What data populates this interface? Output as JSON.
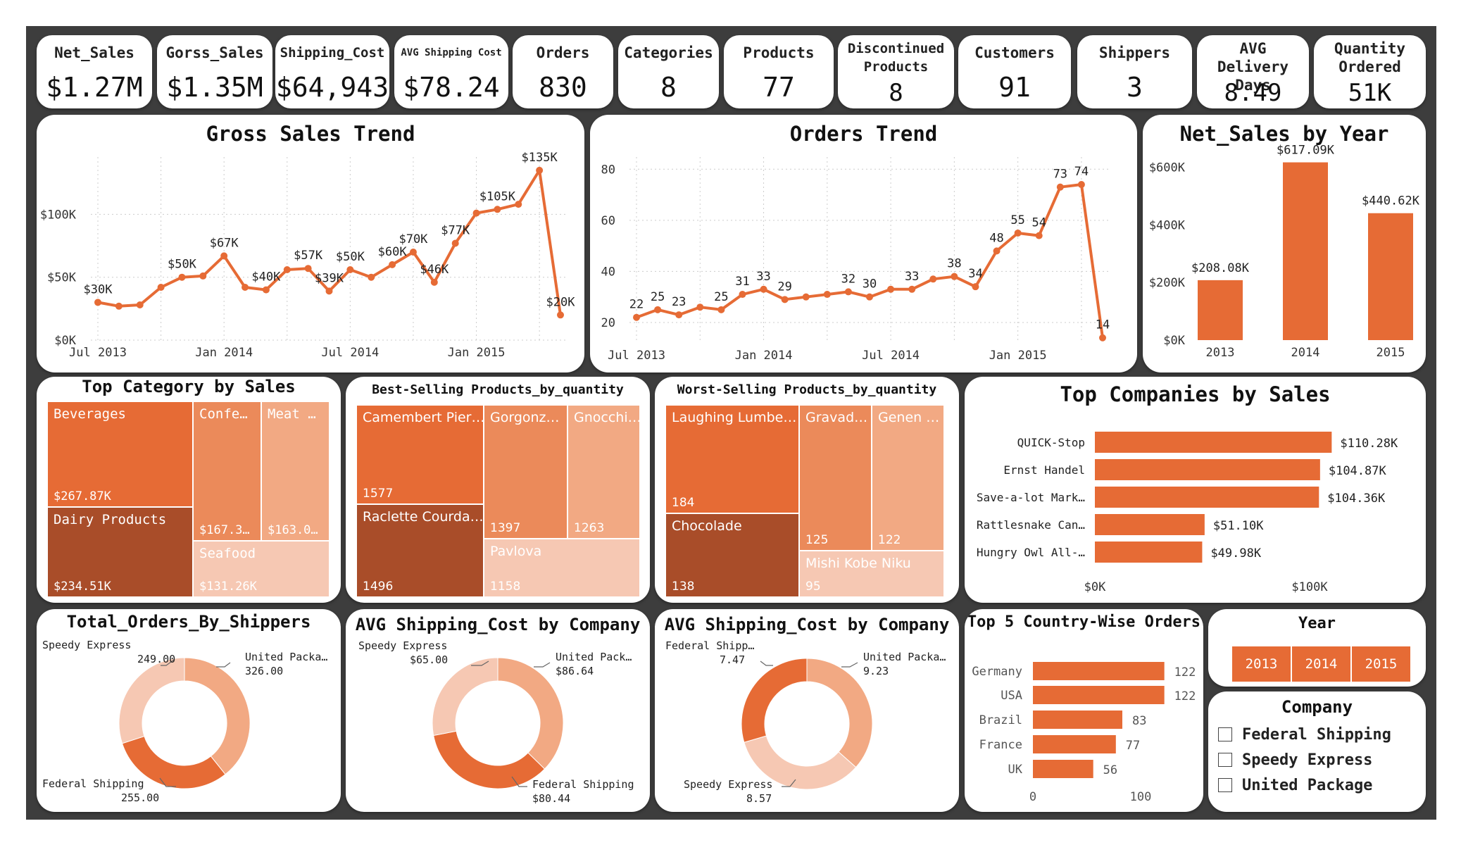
{
  "kpis": [
    {
      "label": "Net_Sales",
      "value": "$1.27M"
    },
    {
      "label": "Gorss_Sales",
      "value": "$1.35M"
    },
    {
      "label": "Shipping_Cost",
      "value": "$64,943"
    },
    {
      "label": "AVG Shipping Cost",
      "value": "$78.24"
    },
    {
      "label": "Orders",
      "value": "830"
    },
    {
      "label": "Categories",
      "value": "8"
    },
    {
      "label": "Products",
      "value": "77"
    },
    {
      "label": "Discontinued Products",
      "value": "8"
    },
    {
      "label": "Customers",
      "value": "91"
    },
    {
      "label": "Shippers",
      "value": "3"
    },
    {
      "label": "AVG Delivery Days",
      "value": "8.49"
    },
    {
      "label": "Quantity Ordered",
      "value": "51K"
    }
  ],
  "colors": {
    "accent": "#e66b35",
    "dark": "#a94d29",
    "mid": "#eb8a5a",
    "light": "#f2a983",
    "pale": "#f6c8b3",
    "frame": "#3d3d3d"
  },
  "chart_data": [
    {
      "type": "line",
      "title": "Gross Sales Trend",
      "x": [
        "2013-07",
        "2013-08",
        "2013-09",
        "2013-10",
        "2013-11",
        "2013-12",
        "2014-01",
        "2014-02",
        "2014-03",
        "2014-04",
        "2014-05",
        "2014-06",
        "2014-07",
        "2014-08",
        "2014-09",
        "2014-10",
        "2014-11",
        "2014-12",
        "2015-01",
        "2015-02",
        "2015-03",
        "2015-04",
        "2015-05"
      ],
      "values": [
        30000,
        27000,
        28000,
        42000,
        50000,
        51000,
        67000,
        42000,
        40000,
        56000,
        57000,
        39000,
        56000,
        50000,
        60000,
        70000,
        46000,
        77000,
        101000,
        104000,
        108000,
        135000,
        20000
      ],
      "point_labels": [
        "$30K",
        "",
        "",
        "",
        "$50K",
        "",
        "$67K",
        "",
        "$40K",
        "",
        "$57K",
        "$39K",
        "$50K",
        "",
        "$60K",
        "$70K",
        "$46K",
        "$77K",
        "",
        "$105K",
        "",
        "$135K",
        "$20K"
      ],
      "x_ticks": [
        "Jul 2013",
        "Jan 2014",
        "Jul 2014",
        "Jan 2015"
      ],
      "y_ticks": [
        "$0K",
        "$50K",
        "$100K"
      ],
      "ylim": [
        0,
        140000
      ],
      "grid": true
    },
    {
      "type": "line",
      "title": "Orders Trend",
      "x": [
        "2013-07",
        "2013-08",
        "2013-09",
        "2013-10",
        "2013-11",
        "2013-12",
        "2014-01",
        "2014-02",
        "2014-03",
        "2014-04",
        "2014-05",
        "2014-06",
        "2014-07",
        "2014-08",
        "2014-09",
        "2014-10",
        "2014-11",
        "2014-12",
        "2015-01",
        "2015-02",
        "2015-03",
        "2015-04",
        "2015-05"
      ],
      "values": [
        22,
        25,
        23,
        26,
        25,
        31,
        33,
        29,
        30,
        31,
        32,
        30,
        33,
        33,
        37,
        38,
        34,
        48,
        55,
        54,
        73,
        74,
        14
      ],
      "point_labels": [
        "22",
        "25",
        "23",
        "",
        "25",
        "31",
        "33",
        "29",
        "",
        "",
        "32",
        "30",
        "",
        "33",
        "",
        "38",
        "34",
        "48",
        "55",
        "54",
        "73",
        "74",
        "14"
      ],
      "x_ticks": [
        "Jul 2013",
        "Jan 2014",
        "Jul 2014",
        "Jan 2015"
      ],
      "y_ticks": [
        "20",
        "40",
        "60",
        "80"
      ],
      "ylim": [
        12,
        82
      ],
      "grid": true
    },
    {
      "type": "bar",
      "title": "Net_Sales by Year",
      "categories": [
        "2013",
        "2014",
        "2015"
      ],
      "values": [
        208080,
        617090,
        440620
      ],
      "value_labels": [
        "$208.08K",
        "$617.09K",
        "$440.62K"
      ],
      "y_ticks": [
        "$0K",
        "$200K",
        "$400K",
        "$600K"
      ],
      "ylim": [
        0,
        660000
      ]
    },
    {
      "type": "treemap",
      "title": "Top Category by Sales",
      "items": [
        {
          "name": "Beverages",
          "label": "$267.87K",
          "value": 267870
        },
        {
          "name": "Dairy Products",
          "label": "$234.51K",
          "value": 234510
        },
        {
          "name": "Confe…",
          "label": "$167.3…",
          "value": 167360
        },
        {
          "name": "Meat …",
          "label": "$163.0…",
          "value": 163020
        },
        {
          "name": "Seafood",
          "label": "$131.26K",
          "value": 131260
        }
      ]
    },
    {
      "type": "treemap",
      "title": "Best-Selling Products_by_quantity",
      "items": [
        {
          "name": "Camembert Pier…",
          "label": "1577",
          "value": 1577
        },
        {
          "name": "Raclette Courda…",
          "label": "1496",
          "value": 1496
        },
        {
          "name": "Gorgonz…",
          "label": "1397",
          "value": 1397
        },
        {
          "name": "Gnocchi…",
          "label": "1263",
          "value": 1263
        },
        {
          "name": "Pavlova",
          "label": "1158",
          "value": 1158
        }
      ]
    },
    {
      "type": "treemap",
      "title": "Worst-Selling Products_by_quantity",
      "items": [
        {
          "name": "Laughing Lumbe…",
          "label": "184",
          "value": 184
        },
        {
          "name": "Chocolade",
          "label": "138",
          "value": 138
        },
        {
          "name": "Gravad…",
          "label": "125",
          "value": 125
        },
        {
          "name": "Genen …",
          "label": "122",
          "value": 122
        },
        {
          "name": "Mishi Kobe Niku",
          "label": "95",
          "value": 95
        }
      ]
    },
    {
      "type": "bar",
      "title": "Top Companies by Sales",
      "categories": [
        "QUICK-Stop",
        "Ernst Handel",
        "Save-a-lot Mark…",
        "Rattlesnake Can…",
        "Hungry Owl All-…"
      ],
      "values": [
        110280,
        104870,
        104360,
        51100,
        49980
      ],
      "value_labels": [
        "$110.28K",
        "$104.87K",
        "$104.36K",
        "$51.10K",
        "$49.98K"
      ],
      "x_ticks": [
        "$0K",
        "$100K"
      ],
      "xlim": [
        0,
        100000
      ]
    },
    {
      "type": "pie",
      "title": "Total_Orders_By_Shippers",
      "slices": [
        {
          "name": "United Packa…",
          "value": 326,
          "label": "326.00"
        },
        {
          "name": "Federal Shipping",
          "value": 255,
          "label": "255.00"
        },
        {
          "name": "Speedy Express",
          "value": 249,
          "label": "249.00"
        }
      ]
    },
    {
      "type": "pie",
      "title": "AVG Shipping_Cost by Company",
      "slices": [
        {
          "name": "United Pack…",
          "value": 86.64,
          "label": "$86.64"
        },
        {
          "name": "Federal Shipping",
          "value": 80.44,
          "label": "$80.44"
        },
        {
          "name": "Speedy Express",
          "value": 65.0,
          "label": "$65.00"
        }
      ]
    },
    {
      "type": "pie",
      "title": "AVG Shipping_Cost by Company",
      "slices": [
        {
          "name": "United Packa…",
          "value": 9.23,
          "label": "9.23"
        },
        {
          "name": "Speedy Express",
          "value": 8.57,
          "label": "8.57"
        },
        {
          "name": "Federal Shipp…",
          "value": 7.47,
          "label": "7.47"
        }
      ]
    },
    {
      "type": "bar",
      "title": "Top 5 Country-Wise Orders",
      "categories": [
        "Germany",
        "USA",
        "Brazil",
        "France",
        "UK"
      ],
      "values": [
        122,
        122,
        83,
        77,
        56
      ],
      "value_labels": [
        "122",
        "122",
        "83",
        "77",
        "56"
      ],
      "x_ticks": [
        "0",
        "100"
      ],
      "xlim": [
        0,
        100
      ]
    }
  ],
  "year_slicer": {
    "title": "Year",
    "options": [
      "2013",
      "2014",
      "2015"
    ]
  },
  "company_slicer": {
    "title": "Company",
    "options": [
      "Federal Shipping",
      "Speedy Express",
      "United Package"
    ]
  }
}
